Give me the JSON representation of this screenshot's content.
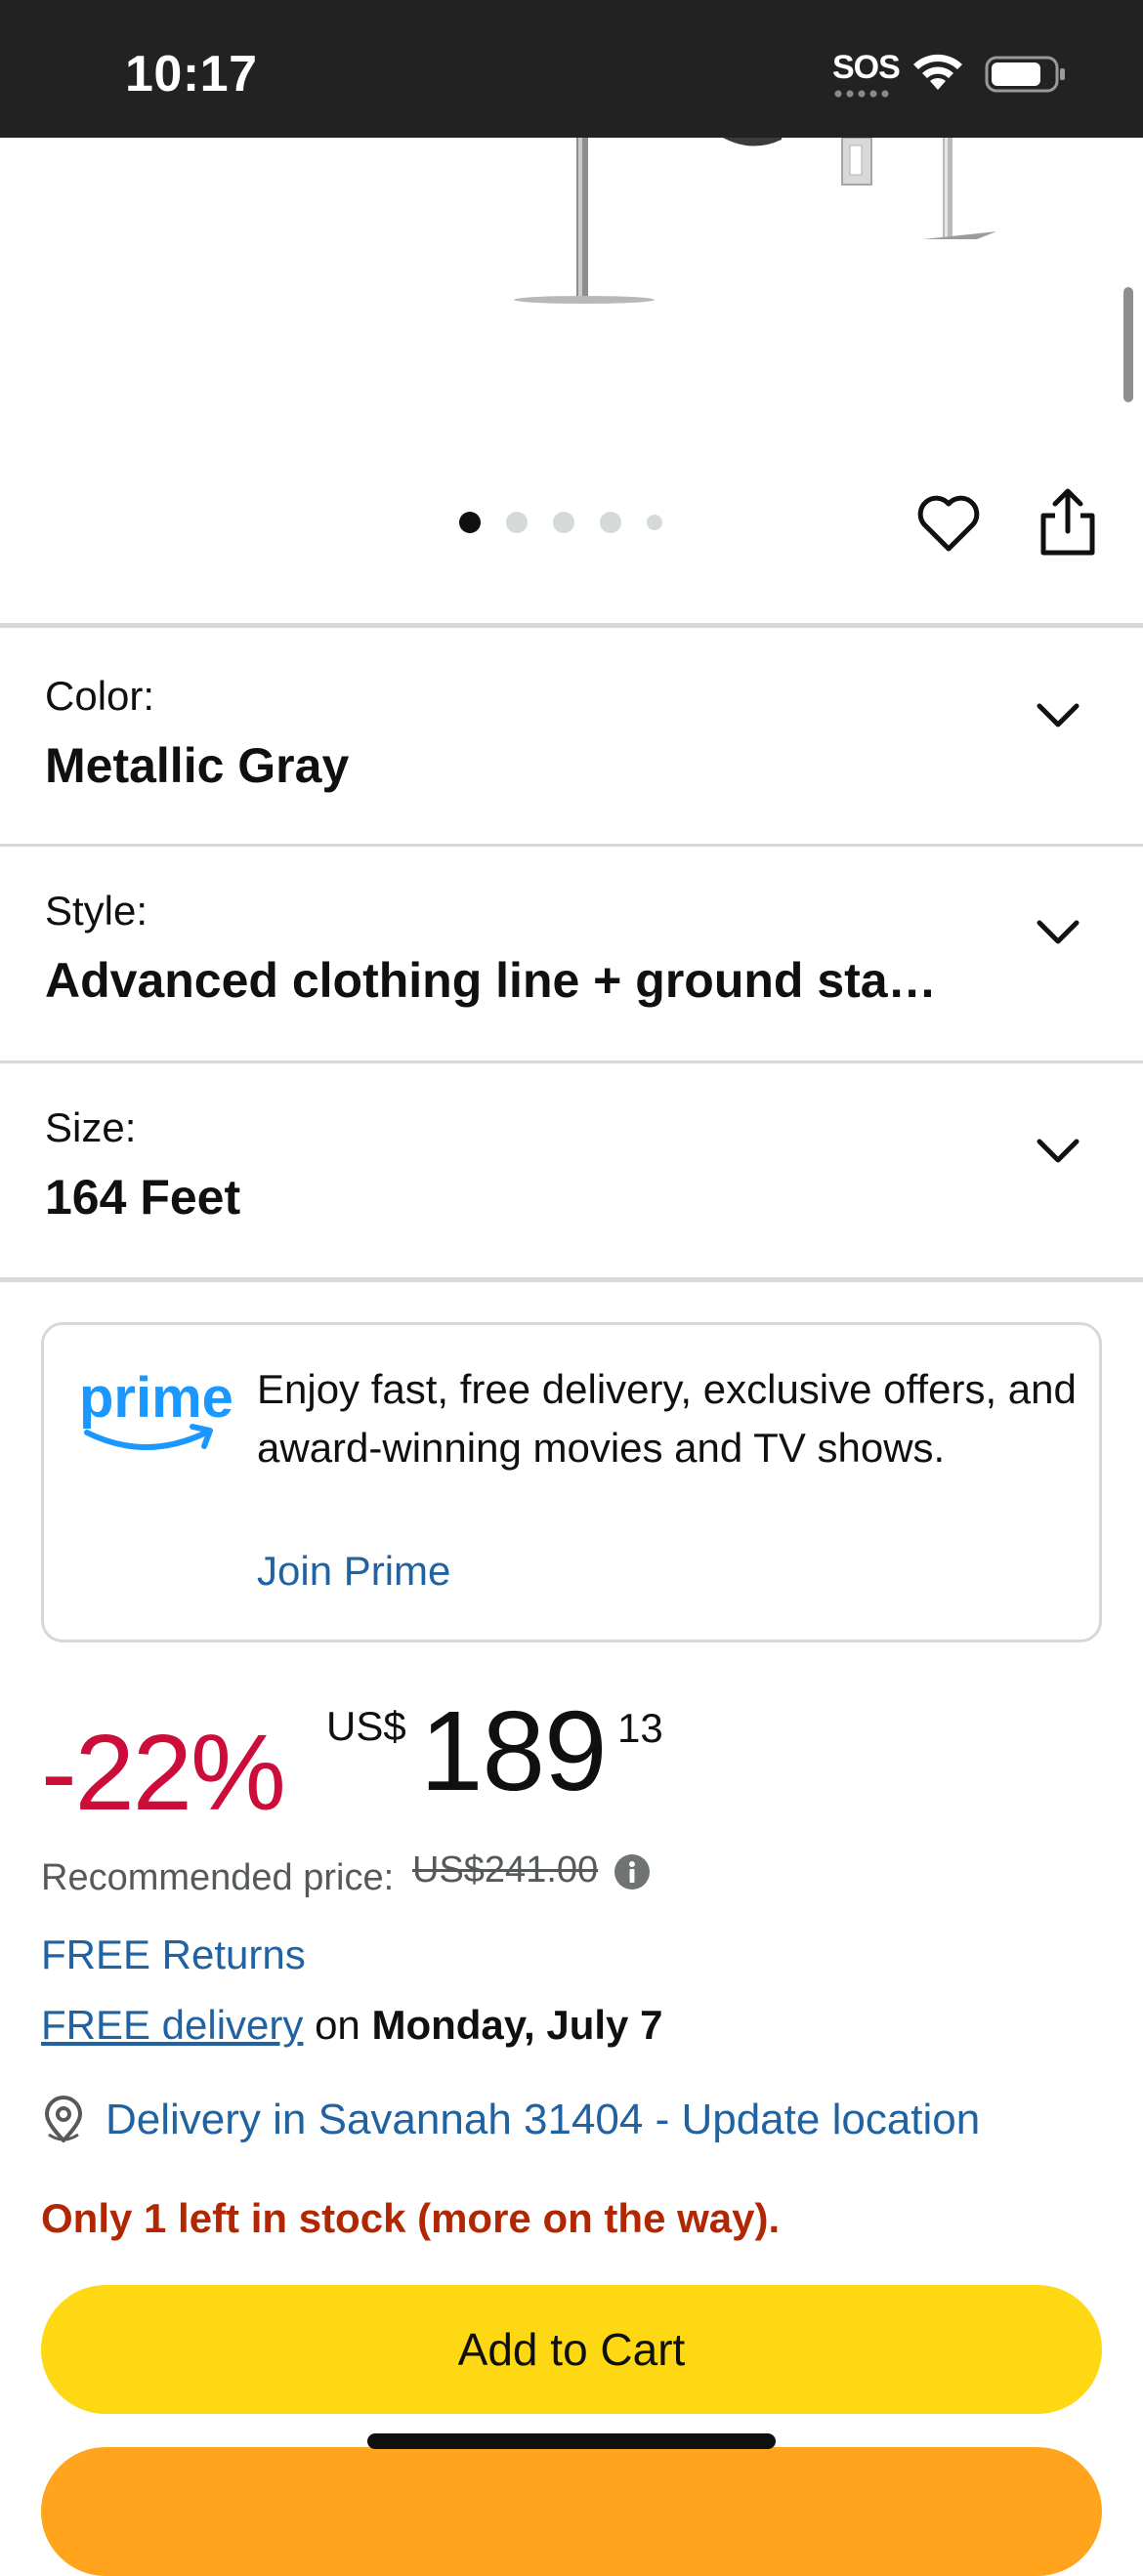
{
  "status_bar": {
    "time": "10:17",
    "sos": "SOS",
    "wifi_icon": "wifi-icon",
    "battery_icon": "battery-icon"
  },
  "carousel": {
    "total_dots": 5,
    "active_index": 0,
    "wishlist_icon": "heart-icon",
    "share_icon": "share-icon"
  },
  "variations": [
    {
      "label": "Color:",
      "value": "Metallic Gray"
    },
    {
      "label": "Style:",
      "value": "Advanced clothing line + ground sta…"
    },
    {
      "label": "Size:",
      "value": "164 Feet"
    }
  ],
  "prime": {
    "logo_text": "prime",
    "description": "Enjoy fast, free delivery, exclusive offers, and award-winning movies and TV shows.",
    "link": "Join Prime"
  },
  "price": {
    "discount": "-22%",
    "currency": "US$",
    "whole": "189",
    "fraction": "13",
    "recommended_label": "Recommended price:",
    "recommended_value": "US$241.00"
  },
  "delivery": {
    "free_returns": "FREE Returns",
    "free_delivery_link": "FREE delivery",
    "on_text": " on ",
    "date": "Monday, July 7",
    "location": "Delivery in Savannah 31404 - Update location"
  },
  "stock": "Only 1 left in stock (more on the way).",
  "actions": {
    "add_to_cart": "Add to Cart"
  },
  "colors": {
    "discount": "#cc0c39",
    "link": "#2162a1",
    "stock": "#b12704",
    "add_to_cart": "#ffd814",
    "buy_now": "#ffa41c",
    "prime_blue": "#1a98ff"
  }
}
